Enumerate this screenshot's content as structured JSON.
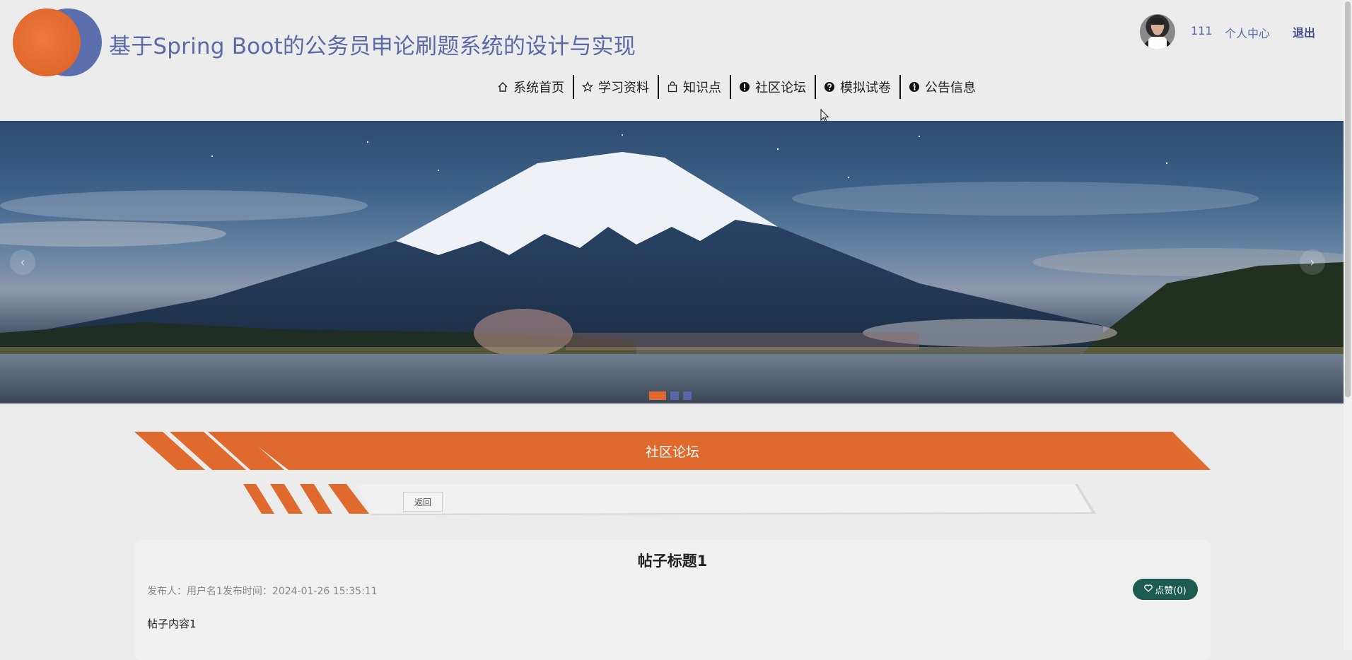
{
  "header": {
    "title": "基于Spring Boot的公务员申论刷题系统的设计与实现",
    "user": {
      "name": "111",
      "center_label": "个人中心",
      "logout_label": "退出"
    },
    "nav": [
      {
        "label": "系统首页",
        "icon": "home-icon"
      },
      {
        "label": "学习资料",
        "icon": "star-icon"
      },
      {
        "label": "知识点",
        "icon": "bag-icon"
      },
      {
        "label": "社区论坛",
        "icon": "alert-circle-icon"
      },
      {
        "label": "模拟试卷",
        "icon": "help-circle-icon"
      },
      {
        "label": "公告信息",
        "icon": "info-circle-icon"
      }
    ]
  },
  "banner": {
    "slide_count": 3,
    "active_index": 0,
    "prev_arrow": "‹",
    "next_arrow": "›"
  },
  "section": {
    "title": "社区论坛",
    "back_label": "返回"
  },
  "post": {
    "title": "帖子标题1",
    "meta": "发布人：用户名1发布时间：2024-01-26 15:35:11",
    "like_label": "点赞(0)",
    "content": "帖子内容1"
  },
  "colors": {
    "accent_orange": "#e06a2e",
    "accent_blue": "#5a6aa8",
    "like_green": "#1e5b4f"
  }
}
